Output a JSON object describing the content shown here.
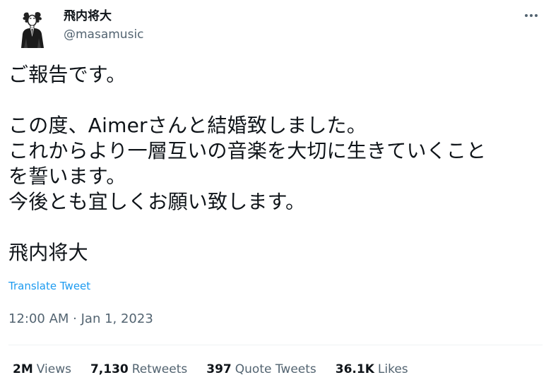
{
  "author": {
    "display_name": "飛内将大",
    "handle": "@masamusic",
    "avatar_icon": "avatar-suit-figure-icon"
  },
  "menu": {
    "more_icon": "more-dots-icon"
  },
  "tweet": {
    "text": "ご報告です。\n\nこの度、Aimerさんと結婚致しました。\nこれからより一層互いの音楽を大切に生きていくこと\nを誓います。\n今後とも宜しくお願い致します。\n\n飛内将大",
    "translate_label": "Translate Tweet",
    "timestamp": "12:00 AM · Jan 1, 2023"
  },
  "stats": [
    {
      "count": "2M",
      "label": "Views"
    },
    {
      "count": "7,130",
      "label": "Retweets"
    },
    {
      "count": "397",
      "label": "Quote Tweets"
    },
    {
      "count": "36.1K",
      "label": "Likes"
    }
  ],
  "colors": {
    "text": "#0f1419",
    "secondary": "#536471",
    "link": "#1d9bf0",
    "divider": "#eff3f4"
  }
}
